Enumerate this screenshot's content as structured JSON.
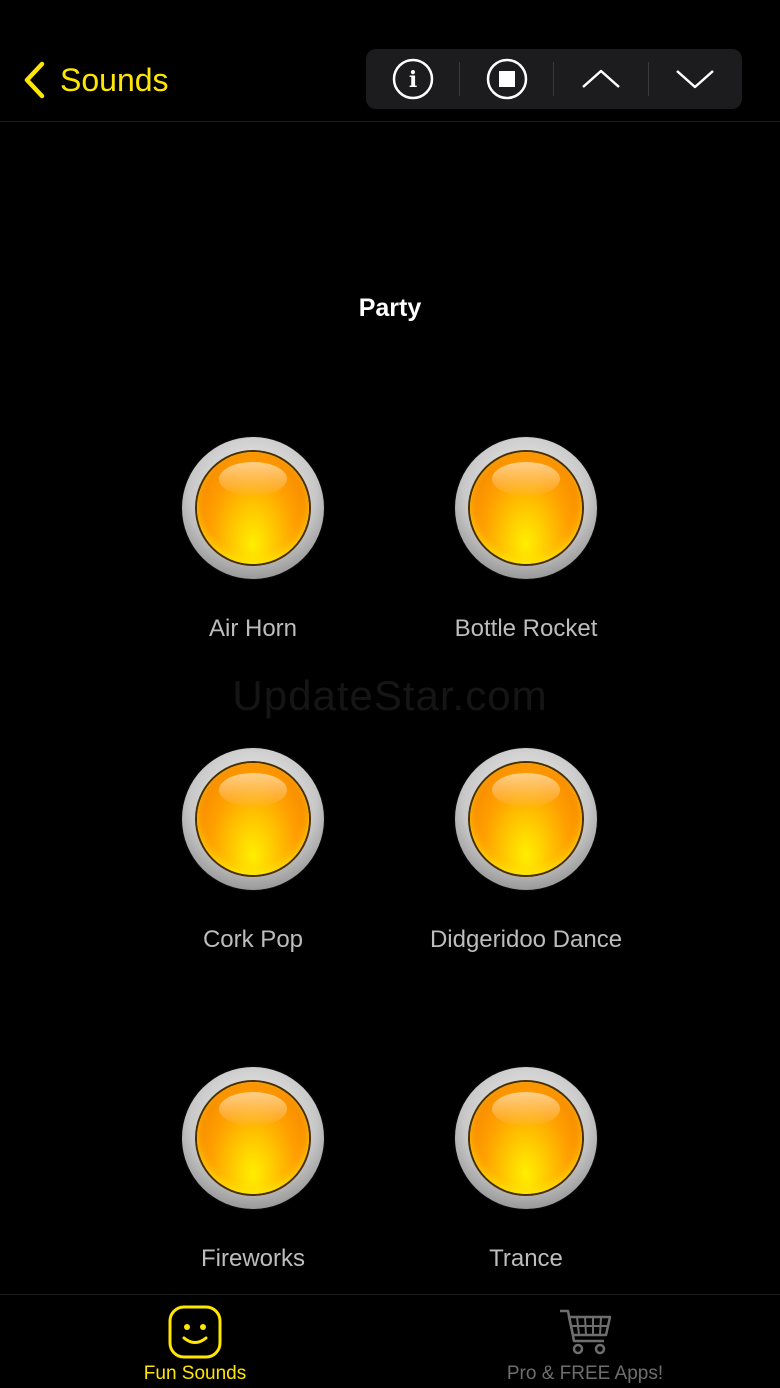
{
  "nav": {
    "back_label": "Sounds"
  },
  "toolbar": {
    "buttons": [
      "info-icon",
      "stop-icon",
      "chevron-up-icon",
      "chevron-down-icon"
    ]
  },
  "section": {
    "title": "Party"
  },
  "watermark": "UpdateStar.com",
  "sounds": [
    {
      "label": "Air Horn"
    },
    {
      "label": "Bottle Rocket"
    },
    {
      "label": "Cork Pop"
    },
    {
      "label": "Didgeridoo Dance"
    },
    {
      "label": "Fireworks"
    },
    {
      "label": "Trance"
    }
  ],
  "tabs": [
    {
      "label": "Fun Sounds",
      "icon": "smiley-icon",
      "active": true
    },
    {
      "label": "Pro & FREE Apps!",
      "icon": "cart-icon",
      "active": false
    }
  ],
  "colors": {
    "accent": "#ffe600",
    "inactive": "#6e6e6e",
    "background": "#000000"
  }
}
